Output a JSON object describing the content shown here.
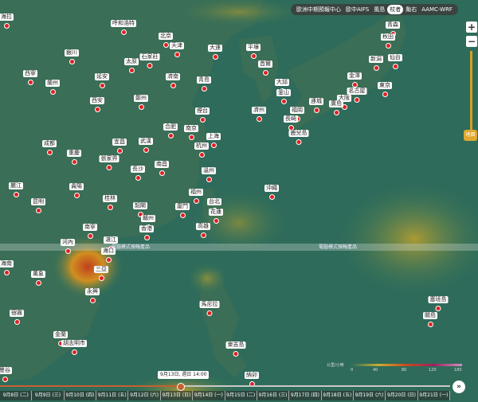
{
  "top_tabs": [
    {
      "label": "歐洲中期預報中心",
      "active": false
    },
    {
      "label": "歐中AIFS",
      "active": false
    },
    {
      "label": "風島",
      "active": false
    },
    {
      "label": "杖者",
      "active": true
    },
    {
      "label": "颱右",
      "active": false
    },
    {
      "label": "AAMC-WRF",
      "active": false
    }
  ],
  "zoom": {
    "in": "+",
    "out": "−"
  },
  "slider_label": "地面",
  "banner_text": "電腦模式預報產品",
  "legend": {
    "title": "公里/小時",
    "ticks": [
      "0",
      "40",
      "80",
      "120",
      "180"
    ]
  },
  "timeline": {
    "tooltip": "9月13日, 週日 14:00",
    "days": [
      "9月8日 (二)",
      "9月9日 (三)",
      "9月10日 (四)",
      "9月11日 (五)",
      "9月12日 (六)",
      "9月13日 (日)",
      "9月14日 (一)",
      "9月15日 (二)",
      "9月16日 (三)",
      "9月17日 (四)",
      "9月18日 (五)",
      "9月19日 (六)",
      "9月20日 (日)",
      "9月21日 (一)"
    ],
    "next_icon": "»",
    "progress": 0.4
  },
  "colors": {
    "sea": "#2f6b5a",
    "marker": "#e02020",
    "accent": "#c86030"
  },
  "cities": [
    "海拉",
    "呼和浩特",
    "北京",
    "天津",
    "大連",
    "平壤",
    "青森",
    "秋田",
    "銀川",
    "太原",
    "石家莊",
    "首爾",
    "新潟",
    "仙台",
    "西寧",
    "延安",
    "濟南",
    "青島",
    "大邱",
    "金澤",
    "東京",
    "蘭州",
    "鄭州",
    "釜山",
    "名古屋",
    "大阪",
    "西安",
    "煙台",
    "福岡",
    "廣島",
    "連城",
    "濟州",
    "長崎",
    "合肥",
    "南京",
    "成都",
    "上海",
    "鹿兒島",
    "宜昌",
    "武漢",
    "杭州",
    "重慶",
    "張家界",
    "南昌",
    "長沙",
    "溫州",
    "貴陽",
    "福州",
    "台北",
    "沖繩",
    "麗江",
    "桂林",
    "韶關",
    "廈門",
    "花蓮",
    "昆明",
    "贛州",
    "高雄",
    "香港",
    "南寧",
    "湛江",
    "河內",
    "海口",
    "三亞",
    "海南",
    "萬象",
    "永興",
    "馬尼拉",
    "塞班島",
    "關島",
    "曼谷",
    "金蘭",
    "胡志明市",
    "宿霧",
    "柬吉島",
    "納卯"
  ]
}
